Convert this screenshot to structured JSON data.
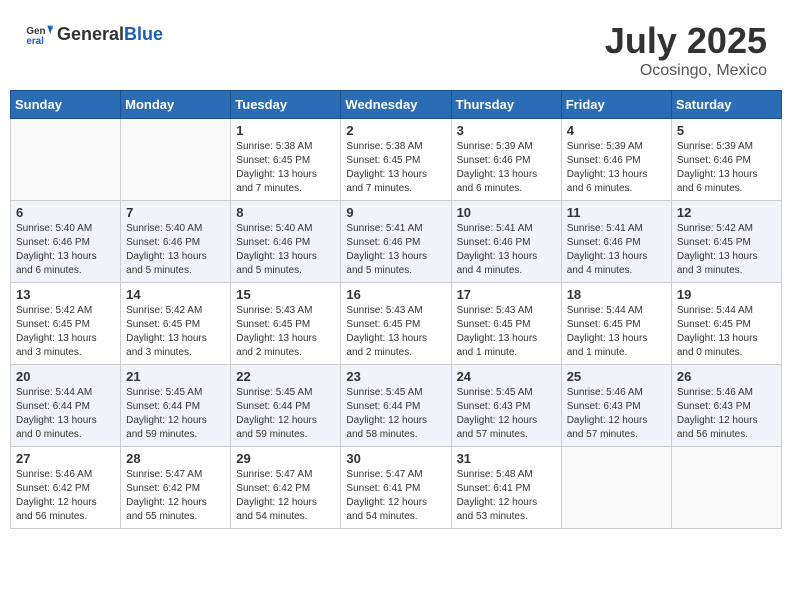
{
  "header": {
    "logo_general": "General",
    "logo_blue": "Blue",
    "month_year": "July 2025",
    "location": "Ocosingo, Mexico"
  },
  "weekdays": [
    "Sunday",
    "Monday",
    "Tuesday",
    "Wednesday",
    "Thursday",
    "Friday",
    "Saturday"
  ],
  "weeks": [
    [
      {
        "day": "",
        "info": ""
      },
      {
        "day": "",
        "info": ""
      },
      {
        "day": "1",
        "info": "Sunrise: 5:38 AM\nSunset: 6:45 PM\nDaylight: 13 hours and 7 minutes."
      },
      {
        "day": "2",
        "info": "Sunrise: 5:38 AM\nSunset: 6:45 PM\nDaylight: 13 hours and 7 minutes."
      },
      {
        "day": "3",
        "info": "Sunrise: 5:39 AM\nSunset: 6:46 PM\nDaylight: 13 hours and 6 minutes."
      },
      {
        "day": "4",
        "info": "Sunrise: 5:39 AM\nSunset: 6:46 PM\nDaylight: 13 hours and 6 minutes."
      },
      {
        "day": "5",
        "info": "Sunrise: 5:39 AM\nSunset: 6:46 PM\nDaylight: 13 hours and 6 minutes."
      }
    ],
    [
      {
        "day": "6",
        "info": "Sunrise: 5:40 AM\nSunset: 6:46 PM\nDaylight: 13 hours and 6 minutes."
      },
      {
        "day": "7",
        "info": "Sunrise: 5:40 AM\nSunset: 6:46 PM\nDaylight: 13 hours and 5 minutes."
      },
      {
        "day": "8",
        "info": "Sunrise: 5:40 AM\nSunset: 6:46 PM\nDaylight: 13 hours and 5 minutes."
      },
      {
        "day": "9",
        "info": "Sunrise: 5:41 AM\nSunset: 6:46 PM\nDaylight: 13 hours and 5 minutes."
      },
      {
        "day": "10",
        "info": "Sunrise: 5:41 AM\nSunset: 6:46 PM\nDaylight: 13 hours and 4 minutes."
      },
      {
        "day": "11",
        "info": "Sunrise: 5:41 AM\nSunset: 6:46 PM\nDaylight: 13 hours and 4 minutes."
      },
      {
        "day": "12",
        "info": "Sunrise: 5:42 AM\nSunset: 6:45 PM\nDaylight: 13 hours and 3 minutes."
      }
    ],
    [
      {
        "day": "13",
        "info": "Sunrise: 5:42 AM\nSunset: 6:45 PM\nDaylight: 13 hours and 3 minutes."
      },
      {
        "day": "14",
        "info": "Sunrise: 5:42 AM\nSunset: 6:45 PM\nDaylight: 13 hours and 3 minutes."
      },
      {
        "day": "15",
        "info": "Sunrise: 5:43 AM\nSunset: 6:45 PM\nDaylight: 13 hours and 2 minutes."
      },
      {
        "day": "16",
        "info": "Sunrise: 5:43 AM\nSunset: 6:45 PM\nDaylight: 13 hours and 2 minutes."
      },
      {
        "day": "17",
        "info": "Sunrise: 5:43 AM\nSunset: 6:45 PM\nDaylight: 13 hours and 1 minute."
      },
      {
        "day": "18",
        "info": "Sunrise: 5:44 AM\nSunset: 6:45 PM\nDaylight: 13 hours and 1 minute."
      },
      {
        "day": "19",
        "info": "Sunrise: 5:44 AM\nSunset: 6:45 PM\nDaylight: 13 hours and 0 minutes."
      }
    ],
    [
      {
        "day": "20",
        "info": "Sunrise: 5:44 AM\nSunset: 6:44 PM\nDaylight: 13 hours and 0 minutes."
      },
      {
        "day": "21",
        "info": "Sunrise: 5:45 AM\nSunset: 6:44 PM\nDaylight: 12 hours and 59 minutes."
      },
      {
        "day": "22",
        "info": "Sunrise: 5:45 AM\nSunset: 6:44 PM\nDaylight: 12 hours and 59 minutes."
      },
      {
        "day": "23",
        "info": "Sunrise: 5:45 AM\nSunset: 6:44 PM\nDaylight: 12 hours and 58 minutes."
      },
      {
        "day": "24",
        "info": "Sunrise: 5:45 AM\nSunset: 6:43 PM\nDaylight: 12 hours and 57 minutes."
      },
      {
        "day": "25",
        "info": "Sunrise: 5:46 AM\nSunset: 6:43 PM\nDaylight: 12 hours and 57 minutes."
      },
      {
        "day": "26",
        "info": "Sunrise: 5:46 AM\nSunset: 6:43 PM\nDaylight: 12 hours and 56 minutes."
      }
    ],
    [
      {
        "day": "27",
        "info": "Sunrise: 5:46 AM\nSunset: 6:42 PM\nDaylight: 12 hours and 56 minutes."
      },
      {
        "day": "28",
        "info": "Sunrise: 5:47 AM\nSunset: 6:42 PM\nDaylight: 12 hours and 55 minutes."
      },
      {
        "day": "29",
        "info": "Sunrise: 5:47 AM\nSunset: 6:42 PM\nDaylight: 12 hours and 54 minutes."
      },
      {
        "day": "30",
        "info": "Sunrise: 5:47 AM\nSunset: 6:41 PM\nDaylight: 12 hours and 54 minutes."
      },
      {
        "day": "31",
        "info": "Sunrise: 5:48 AM\nSunset: 6:41 PM\nDaylight: 12 hours and 53 minutes."
      },
      {
        "day": "",
        "info": ""
      },
      {
        "day": "",
        "info": ""
      }
    ]
  ]
}
